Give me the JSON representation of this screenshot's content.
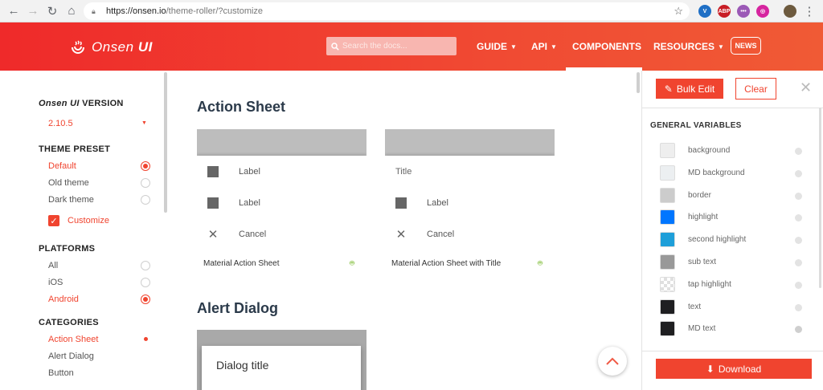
{
  "browser": {
    "url_host": "https://onsen.io",
    "url_path": "/theme-roller/?customize",
    "extensions": [
      {
        "name": "v-extension-icon",
        "label": "V",
        "color": "#1f6fc5"
      },
      {
        "name": "adblock-icon",
        "label": "ABP",
        "color": "#c81d25"
      },
      {
        "name": "purple-extension-icon",
        "label": "•••",
        "color": "#9b59b6"
      },
      {
        "name": "instagram-icon",
        "label": "◎",
        "color": "#d6249f"
      }
    ]
  },
  "header": {
    "logo_text_1": "Onsen",
    "logo_text_2": "UI",
    "search_placeholder": "Search the docs...",
    "menu": [
      {
        "label": "GUIDE",
        "caret": "▼"
      },
      {
        "label": "API",
        "caret": "▼"
      },
      {
        "label": "COMPONENTS",
        "caret": ""
      },
      {
        "label": "RESOURCES",
        "caret": "▼"
      }
    ],
    "news_label": "NEWS"
  },
  "sidebar": {
    "version_title_1": "Onsen",
    "version_title_2": "UI",
    "version_title_3": "VERSION",
    "version_value": "2.10.5",
    "theme_preset_title": "THEME PRESET",
    "theme_presets": [
      {
        "label": "Default",
        "selected": true
      },
      {
        "label": "Old theme",
        "selected": false
      },
      {
        "label": "Dark theme",
        "selected": false
      }
    ],
    "customize_label": "Customize",
    "platforms_title": "PLATFORMS",
    "platforms": [
      {
        "label": "All",
        "selected": false
      },
      {
        "label": "iOS",
        "selected": false
      },
      {
        "label": "Android",
        "selected": true
      }
    ],
    "categories_title": "CATEGORIES",
    "categories": [
      {
        "label": "Action Sheet",
        "selected": true
      },
      {
        "label": "Alert Dialog",
        "selected": false
      },
      {
        "label": "Button",
        "selected": false
      }
    ]
  },
  "main": {
    "action_sheet_title": "Action Sheet",
    "card1": {
      "rows": [
        "Label",
        "Label",
        "Cancel"
      ],
      "caption": "Material Action Sheet"
    },
    "card2": {
      "title": "Title",
      "rows": [
        "Label",
        "Cancel"
      ],
      "caption": "Material Action Sheet with Title"
    },
    "alert_dialog_title": "Alert Dialog",
    "dialog_title": "Dialog title"
  },
  "right_panel": {
    "bulk_edit_label": "Bulk Edit",
    "clear_label": "Clear",
    "general_variables_title": "GENERAL VARIABLES",
    "variables": [
      {
        "name": "background",
        "color": "#eeeeee"
      },
      {
        "name": "MD background",
        "color": "#eceff1"
      },
      {
        "name": "border",
        "color": "#cccccc"
      },
      {
        "name": "highlight",
        "color": "#0076ff"
      },
      {
        "name": "second highlight",
        "color": "#1e9fd9"
      },
      {
        "name": "sub text",
        "color": "#999999"
      },
      {
        "name": "tap highlight",
        "color": "checker"
      },
      {
        "name": "text",
        "color": "#1f1f21"
      },
      {
        "name": "MD text",
        "color": "#1f1f21"
      }
    ],
    "download_label": "Download"
  },
  "colors": {
    "brand": "#f0442f",
    "header_gradient_start": "#ef2a2a",
    "header_gradient_end": "#f05a35",
    "heading": "#2b3a4a",
    "android_green": "#8bc34a"
  }
}
